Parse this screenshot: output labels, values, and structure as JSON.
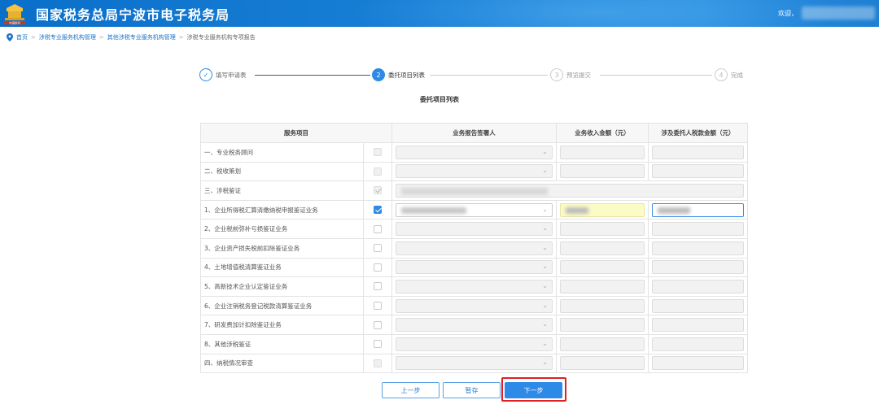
{
  "header": {
    "title": "国家税务总局宁波市电子税务局",
    "welcome": "欢迎，"
  },
  "breadcrumb": [
    {
      "label": "首页"
    },
    {
      "label": "涉税专业服务机构管理"
    },
    {
      "label": "其他涉税专业服务机构管理"
    },
    {
      "label": "涉税专业服务机构专项报告"
    }
  ],
  "steps": [
    {
      "num": "1",
      "label": "填写申请表",
      "state": "done"
    },
    {
      "num": "2",
      "label": "委托项目列表",
      "state": "active"
    },
    {
      "num": "3",
      "label": "预览提交",
      "state": "pending"
    },
    {
      "num": "4",
      "label": "完成",
      "state": "pending"
    }
  ],
  "section_title": "委托项目列表",
  "table": {
    "headers": [
      "服务项目",
      "业务报告签署人",
      "业务收入金额（元）",
      "涉及委托人税款金额（元）"
    ],
    "rows": [
      {
        "name": "一、专业税务顾问",
        "check": "disabled"
      },
      {
        "name": "二、税收策划",
        "check": "disabled"
      },
      {
        "name": "三、涉税鉴证",
        "check": "disabled-checked"
      },
      {
        "name": "1、企业所得税汇算清缴纳税申报鉴证业务",
        "check": "checked"
      },
      {
        "name": "2、企业税前弥补亏损鉴证业务",
        "check": "empty"
      },
      {
        "name": "3、企业资产损失税前扣除鉴证业务",
        "check": "empty"
      },
      {
        "name": "4、土地增值税清算鉴证业务",
        "check": "empty"
      },
      {
        "name": "5、高新技术企业认定鉴证业务",
        "check": "empty"
      },
      {
        "name": "6、企业注销税务登记税款清算鉴证业务",
        "check": "empty"
      },
      {
        "name": "7、研发费加计扣除鉴证业务",
        "check": "empty"
      },
      {
        "name": "8、其他涉税鉴证",
        "check": "empty"
      },
      {
        "name": "四、纳税情况审查",
        "check": "disabled"
      }
    ]
  },
  "buttons": {
    "prev": "上一步",
    "save": "暂存",
    "next": "下一步"
  },
  "icons": {
    "arrow": "⌄",
    "check": "✓"
  }
}
